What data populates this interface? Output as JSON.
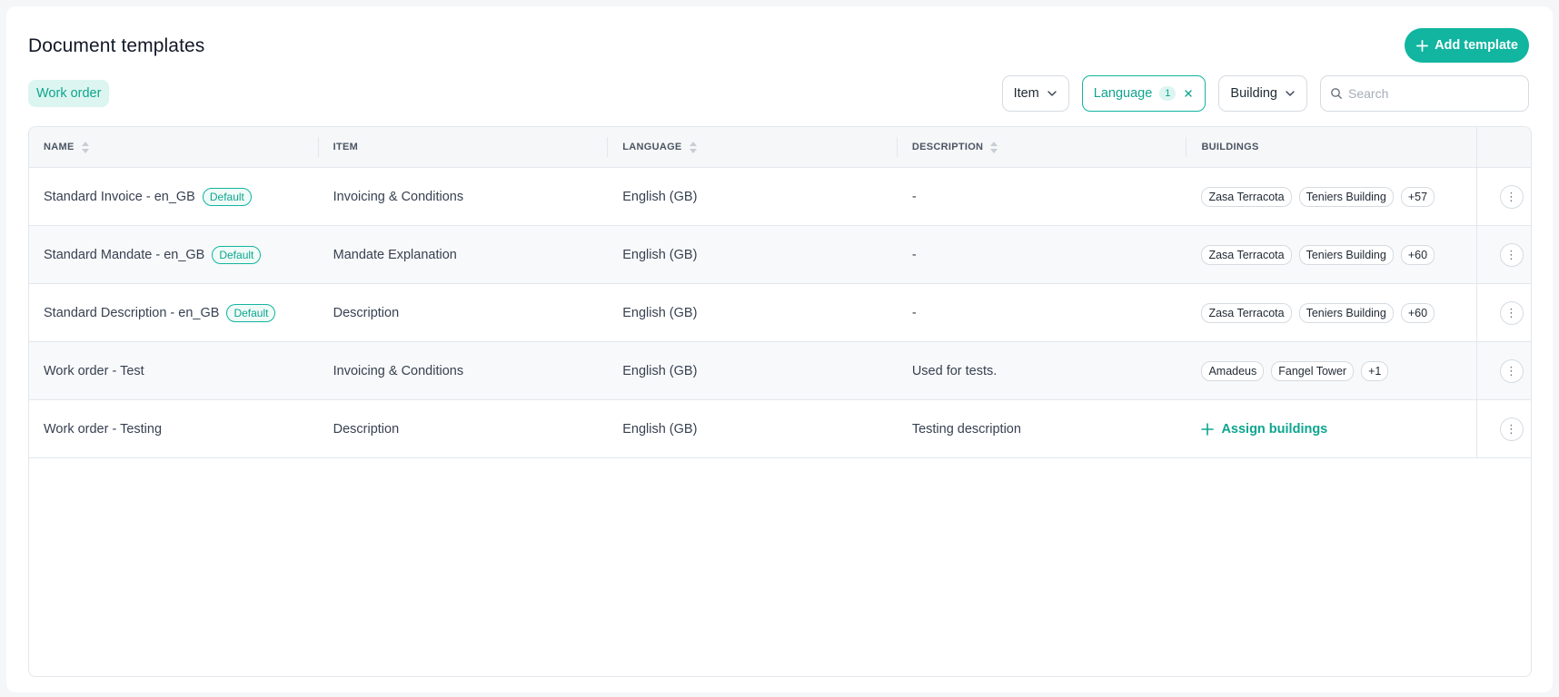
{
  "header": {
    "title": "Document templates",
    "add_button_label": "Add template"
  },
  "active_tab": "Work order",
  "filters": {
    "item_label": "Item",
    "language_label": "Language",
    "language_count": "1",
    "building_label": "Building",
    "search_placeholder": "Search"
  },
  "table": {
    "columns": [
      "NAME",
      "ITEM",
      "LANGUAGE",
      "DESCRIPTION",
      "BUILDINGS"
    ],
    "default_badge": "Default",
    "assign_label": "Assign buildings",
    "rows": [
      {
        "name": "Standard Invoice - en_GB",
        "is_default": true,
        "item": "Invoicing & Conditions",
        "language": "English (GB)",
        "description": "-",
        "buildings": [
          "Zasa Terracota",
          "Teniers Building"
        ],
        "more": "+57"
      },
      {
        "name": "Standard Mandate - en_GB",
        "is_default": true,
        "item": "Mandate Explanation",
        "language": "English (GB)",
        "description": "-",
        "buildings": [
          "Zasa Terracota",
          "Teniers Building"
        ],
        "more": "+60"
      },
      {
        "name": "Standard Description - en_GB",
        "is_default": true,
        "item": "Description",
        "language": "English (GB)",
        "description": "-",
        "buildings": [
          "Zasa Terracota",
          "Teniers Building"
        ],
        "more": "+60"
      },
      {
        "name": "Work order - Test",
        "is_default": false,
        "item": "Invoicing & Conditions",
        "language": "English (GB)",
        "description": "Used for tests.",
        "buildings": [
          "Amadeus",
          "Fangel Tower"
        ],
        "more": "+1"
      },
      {
        "name": "Work order - Testing",
        "is_default": false,
        "item": "Description",
        "language": "English (GB)",
        "description": "Testing description",
        "buildings": [],
        "more": ""
      }
    ]
  },
  "colors": {
    "accent": "#11b5a0",
    "accent_light": "#dcf5f0"
  }
}
